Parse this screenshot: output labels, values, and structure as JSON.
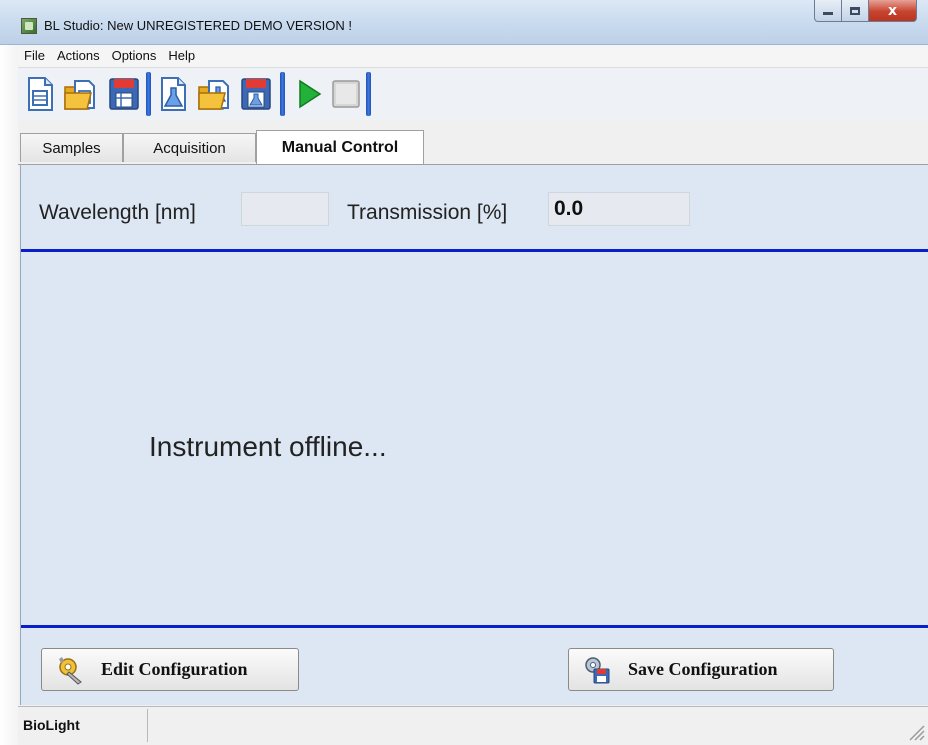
{
  "window": {
    "title": "BL Studio: New   UNREGISTERED DEMO VERSION !",
    "controls": {
      "minimize": "minimize",
      "maximize": "maximize",
      "close": "x"
    }
  },
  "menu": {
    "items": [
      "File",
      "Actions",
      "Options",
      "Help"
    ]
  },
  "toolbar": {
    "buttons": [
      "new-file-icon",
      "open-file-icon",
      "save-file-icon",
      "new-flask-icon",
      "open-flask-icon",
      "save-flask-icon",
      "play-icon",
      "stop-icon"
    ]
  },
  "tabs": [
    {
      "label": "Samples",
      "active": false
    },
    {
      "label": "Acquisition",
      "active": false
    },
    {
      "label": "Manual Control",
      "active": true
    }
  ],
  "panel": {
    "wavelength_label": "Wavelength [nm]",
    "wavelength_value": "",
    "transmission_label": "Transmission [%]",
    "transmission_value": "0.0",
    "status_message": "Instrument offline...",
    "edit_button": "Edit Configuration",
    "save_button": "Save Configuration"
  },
  "statusbar": {
    "app_name": "BioLight"
  },
  "colors": {
    "panel_bg": "#dde6f3",
    "rule": "#0a1fc9",
    "separator": "#2a63d4"
  }
}
